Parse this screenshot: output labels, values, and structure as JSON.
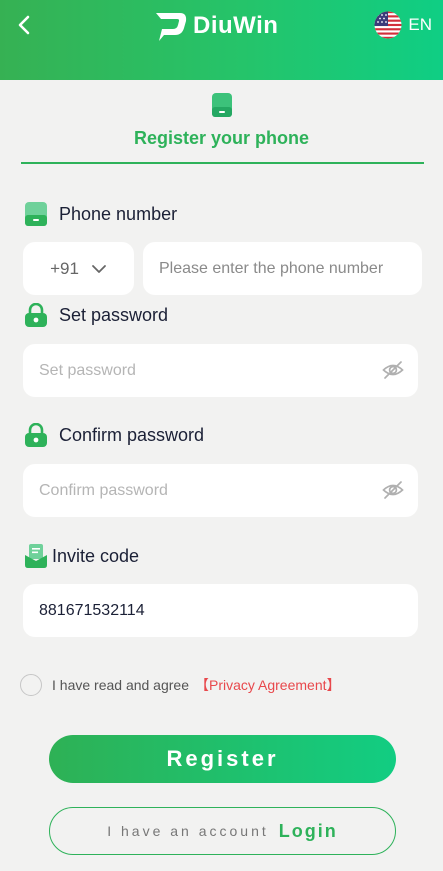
{
  "header": {
    "back_icon": "chevron-left-icon",
    "logo_text": "DiuWin",
    "language": "EN",
    "flag_icon": "us-flag-icon"
  },
  "tab": {
    "icon": "phone-icon",
    "title": "Register your phone"
  },
  "phone": {
    "label": "Phone number",
    "country_code": "+91",
    "placeholder": "Please enter the phone number",
    "value": ""
  },
  "password": {
    "label": "Set password",
    "placeholder": "Set password",
    "value": ""
  },
  "confirm": {
    "label": "Confirm password",
    "placeholder": "Confirm password",
    "value": ""
  },
  "invite": {
    "label": "Invite code",
    "value": "881671532114"
  },
  "agreement": {
    "text": "I have read and agree",
    "link": "【Privacy Agreement】"
  },
  "buttons": {
    "register": "Register",
    "have_account": "I have an account",
    "login": "Login"
  },
  "colors": {
    "brand_green": "#2eb25a",
    "header_gradient_start": "#36b153",
    "header_gradient_end": "#0fce84",
    "link_red": "#e8484c"
  }
}
